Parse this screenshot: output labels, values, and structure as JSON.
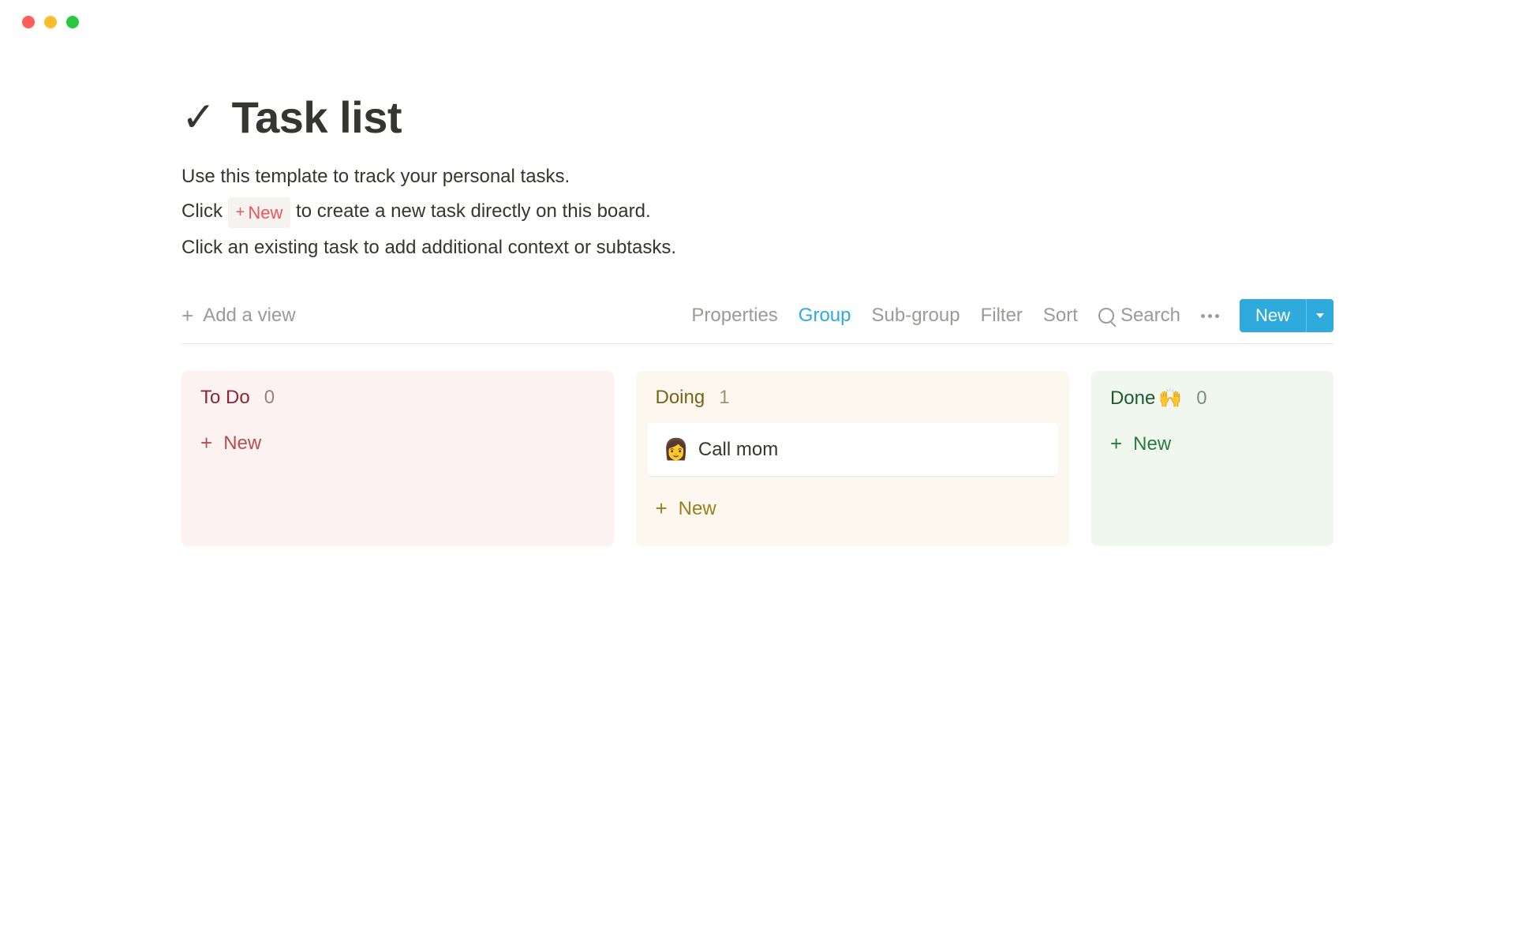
{
  "page": {
    "icon": "✓",
    "title": "Task list",
    "description_line1": "Use this template to track your personal tasks.",
    "description_line2_before": "Click ",
    "description_line2_badge_plus": "+",
    "description_line2_badge_text": "New",
    "description_line2_after": " to create a new task directly on this board.",
    "description_line3": "Click an existing task to add additional context or subtasks."
  },
  "toolbar": {
    "add_view": "Add a view",
    "properties": "Properties",
    "group": "Group",
    "subgroup": "Sub-group",
    "filter": "Filter",
    "sort": "Sort",
    "search": "Search",
    "new_button": "New"
  },
  "board": {
    "columns": [
      {
        "id": "todo",
        "title": "To Do",
        "count": "0",
        "new_label": "New",
        "cards": []
      },
      {
        "id": "doing",
        "title": "Doing",
        "count": "1",
        "new_label": "New",
        "cards": [
          {
            "emoji": "👩",
            "title": "Call mom"
          }
        ]
      },
      {
        "id": "done",
        "title": "Done",
        "emoji": "🙌",
        "count": "0",
        "new_label": "New",
        "cards": []
      }
    ]
  }
}
